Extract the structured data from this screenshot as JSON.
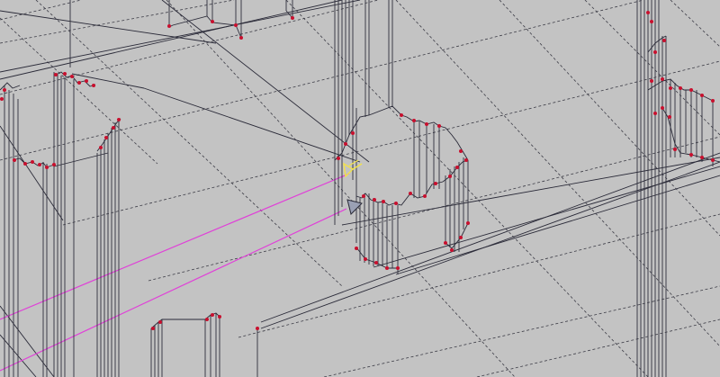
{
  "viewport": {
    "name": "3d-wireframe-viewport",
    "background": "#c3c3c3"
  },
  "colors": {
    "grid": "#3c3c46",
    "edge": "#2a2a38",
    "vertex": "#c8102e",
    "selection_line": "#e040d8",
    "gizmo": "#f2e24a"
  },
  "icons": {
    "gizmo": "yellow-axis-gizmo-icon",
    "cursor": "triangle-cursor-icon"
  }
}
